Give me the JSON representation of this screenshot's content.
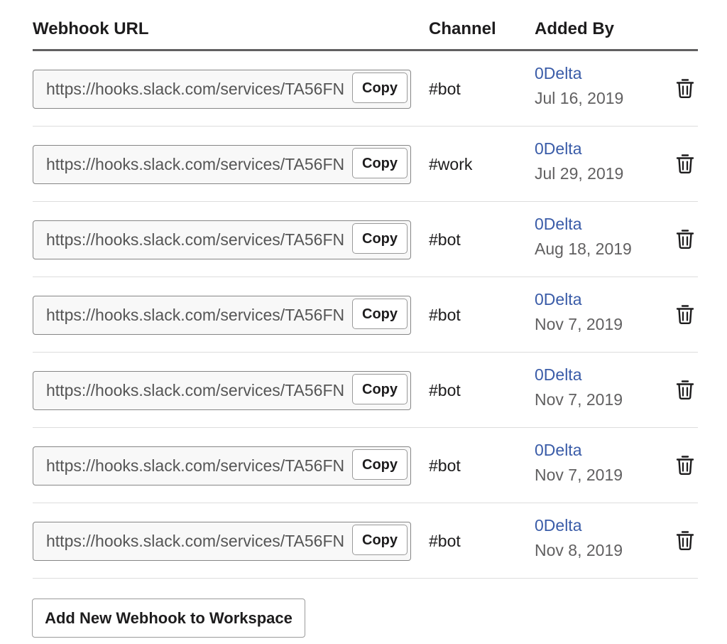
{
  "table": {
    "headers": {
      "webhook_url": "Webhook URL",
      "channel": "Channel",
      "added_by": "Added By"
    },
    "rows": [
      {
        "url": "https://hooks.slack.com/services/TA56FN",
        "copy_label": "Copy",
        "channel": "#bot",
        "user": "0Delta",
        "date": "Jul 16, 2019"
      },
      {
        "url": "https://hooks.slack.com/services/TA56FN",
        "copy_label": "Copy",
        "channel": "#work",
        "user": "0Delta",
        "date": "Jul 29, 2019"
      },
      {
        "url": "https://hooks.slack.com/services/TA56FN",
        "copy_label": "Copy",
        "channel": "#bot",
        "user": "0Delta",
        "date": "Aug 18, 2019"
      },
      {
        "url": "https://hooks.slack.com/services/TA56FN",
        "copy_label": "Copy",
        "channel": "#bot",
        "user": "0Delta",
        "date": "Nov 7, 2019"
      },
      {
        "url": "https://hooks.slack.com/services/TA56FN",
        "copy_label": "Copy",
        "channel": "#bot",
        "user": "0Delta",
        "date": "Nov 7, 2019"
      },
      {
        "url": "https://hooks.slack.com/services/TA56FN",
        "copy_label": "Copy",
        "channel": "#bot",
        "user": "0Delta",
        "date": "Nov 7, 2019"
      },
      {
        "url": "https://hooks.slack.com/services/TA56FN",
        "copy_label": "Copy",
        "channel": "#bot",
        "user": "0Delta",
        "date": "Nov 8, 2019"
      }
    ],
    "row_icon": "trash-icon"
  },
  "add_button": {
    "label": "Add New Webhook to Workspace"
  },
  "colors": {
    "text": "#1d1c1d",
    "link": "#3a5ca8",
    "muted": "#616061",
    "input_bg": "#f8f8f8"
  }
}
